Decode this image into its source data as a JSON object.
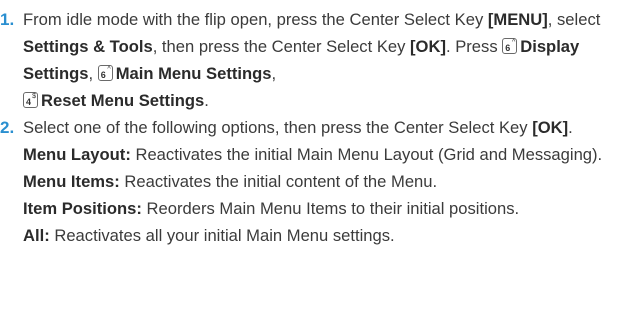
{
  "steps": [
    {
      "number": "1.",
      "t1": "From idle mode with the flip open, press the Center Select Key ",
      "menu_key": "[MENU]",
      "t2": ", select ",
      "settings_tools": "Settings & Tools",
      "t3": ", then press the Center Select Key ",
      "ok_key": "[OK]",
      "t4": ". Press ",
      "key1": {
        "num": "6",
        "sym": "^"
      },
      "display_settings": "Display Settings",
      "sep1": ", ",
      "key2": {
        "num": "6",
        "sym": "^"
      },
      "main_menu_settings": "Main Menu Settings",
      "sep2": ",",
      "key3": {
        "num": "4",
        "sym": "$"
      },
      "reset_menu_settings": "Reset Menu Settings",
      "end": "."
    },
    {
      "number": "2.",
      "t1": "Select one of the following options, then press the Center Select Key ",
      "ok_key": "[OK]",
      "end": "."
    }
  ],
  "options": [
    {
      "label": "Menu Layout:",
      "text": " Reactivates the initial Main Menu Layout (Grid and Messaging)."
    },
    {
      "label": "Menu Items:",
      "text": " Reactivates the initial content of the Menu."
    },
    {
      "label": "Item Positions:",
      "text": " Reorders Main Menu Items to their initial positions."
    },
    {
      "label": "All:",
      "text": " Reactivates all your initial Main Menu settings."
    }
  ],
  "colors": {
    "step_number": "#2a8fd0",
    "text": "#3b3b3b"
  },
  "icons": {
    "key_6": "keypad-6-icon",
    "key_4": "keypad-4-icon"
  }
}
